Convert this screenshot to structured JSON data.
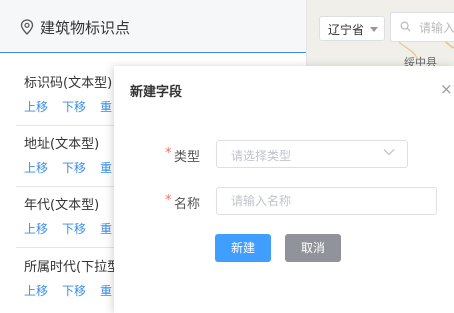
{
  "panel": {
    "title": "建筑物标识点"
  },
  "fields": [
    {
      "name": "标识码(文本型)",
      "actions": [
        "上移",
        "下移",
        "重"
      ]
    },
    {
      "name": "地址(文本型)",
      "actions": [
        "上移",
        "下移",
        "重"
      ]
    },
    {
      "name": "年代(文本型)",
      "actions": [
        "上移",
        "下移",
        "重"
      ]
    },
    {
      "name": "所属时代(下拉型)",
      "actions": [
        "上移",
        "下移",
        "重"
      ]
    }
  ],
  "map": {
    "province": "辽宁省",
    "search_placeholder": "请输入",
    "place_label": "绥中县"
  },
  "dialog": {
    "title": "新建字段",
    "close": "×",
    "required_mark": "*",
    "type_label": "类型",
    "type_placeholder": "请选择类型",
    "name_label": "名称",
    "name_placeholder": "请输入名称",
    "create_button": "新建",
    "cancel_button": "取消"
  },
  "colors": {
    "accent": "#409eff",
    "link": "#3a8ee6",
    "required": "#f56c6c",
    "cancel": "#909399"
  },
  "icons": {
    "panel": "map-pin-icon",
    "search": "search-icon",
    "select": "chevron-down-icon",
    "close": "close-icon"
  }
}
